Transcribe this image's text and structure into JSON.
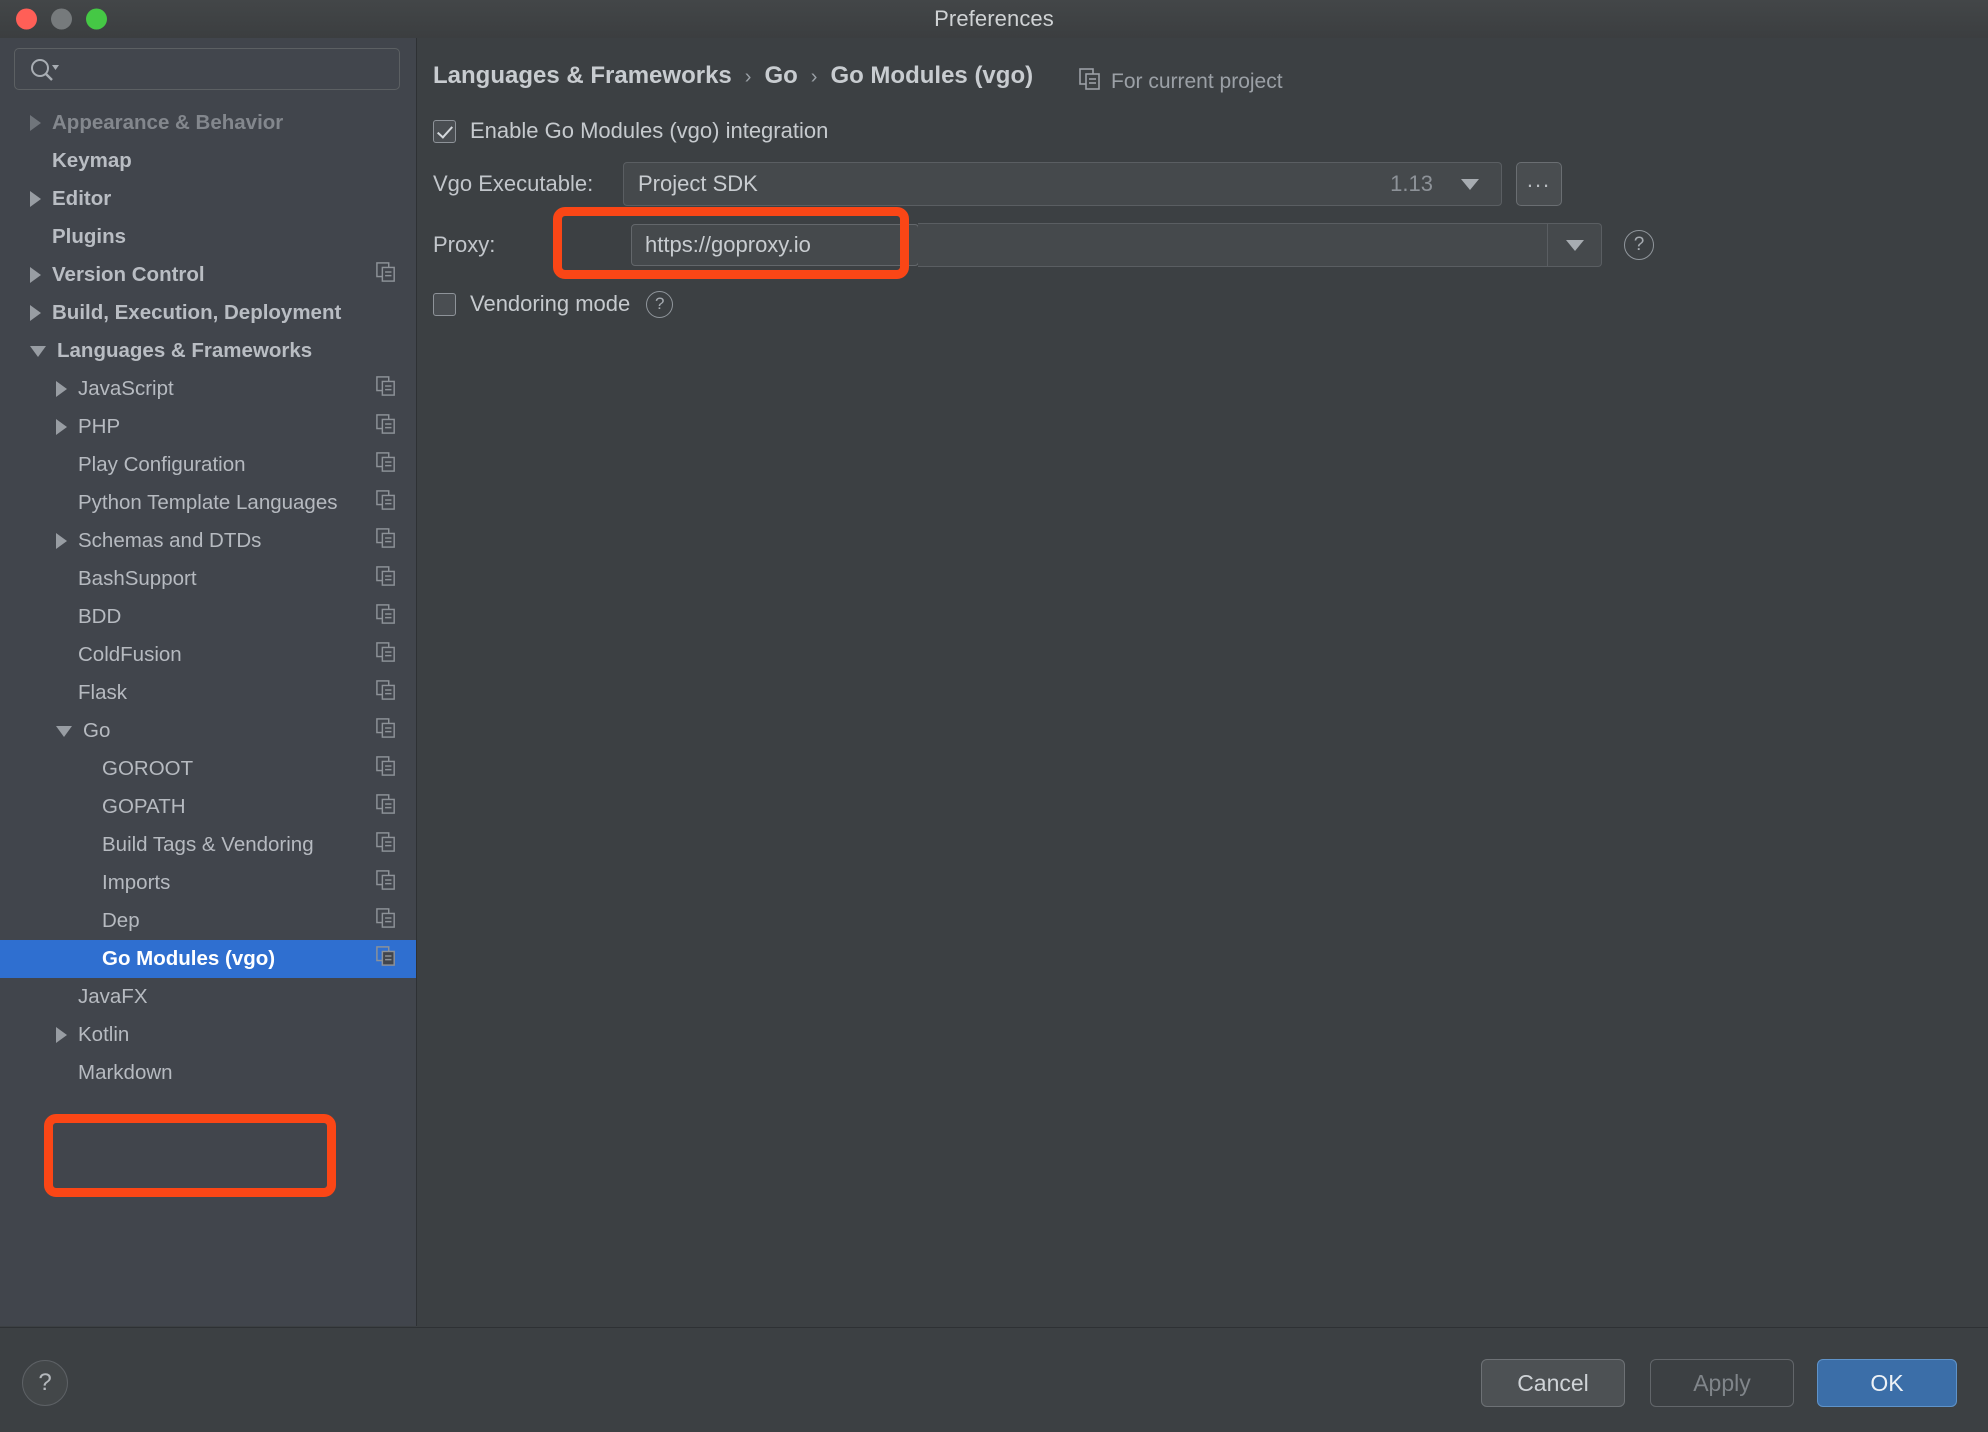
{
  "window": {
    "title": "Preferences",
    "traffic_lights": [
      "close",
      "minimize",
      "maximize"
    ]
  },
  "sidebar": {
    "search": {
      "value": "",
      "placeholder": ""
    },
    "items": [
      {
        "label": "Appearance & Behavior",
        "twisty": "right",
        "level": 0,
        "top": true,
        "faded": true,
        "copy": false
      },
      {
        "label": "Keymap",
        "twisty": "none",
        "level": 0,
        "top": true,
        "copy": false
      },
      {
        "label": "Editor",
        "twisty": "right",
        "level": 0,
        "top": true,
        "copy": false
      },
      {
        "label": "Plugins",
        "twisty": "none",
        "level": 0,
        "top": true,
        "copy": false
      },
      {
        "label": "Version Control",
        "twisty": "right",
        "level": 0,
        "top": true,
        "copy": true
      },
      {
        "label": "Build, Execution, Deployment",
        "twisty": "right",
        "level": 0,
        "top": true,
        "copy": false
      },
      {
        "label": "Languages & Frameworks",
        "twisty": "down",
        "level": 0,
        "top": true,
        "copy": false
      },
      {
        "label": "JavaScript",
        "twisty": "right",
        "level": 1,
        "copy": true
      },
      {
        "label": "PHP",
        "twisty": "right",
        "level": 1,
        "copy": true
      },
      {
        "label": "Play Configuration",
        "twisty": "none",
        "level": 1,
        "copy": true
      },
      {
        "label": "Python Template Languages",
        "twisty": "none",
        "level": 1,
        "copy": true
      },
      {
        "label": "Schemas and DTDs",
        "twisty": "right",
        "level": 1,
        "copy": true
      },
      {
        "label": "BashSupport",
        "twisty": "none",
        "level": 1,
        "copy": true
      },
      {
        "label": "BDD",
        "twisty": "none",
        "level": 1,
        "copy": true
      },
      {
        "label": "ColdFusion",
        "twisty": "none",
        "level": 1,
        "copy": true
      },
      {
        "label": "Flask",
        "twisty": "none",
        "level": 1,
        "copy": true
      },
      {
        "label": "Go",
        "twisty": "down",
        "level": 1,
        "copy": true
      },
      {
        "label": "GOROOT",
        "twisty": "none",
        "level": 2,
        "copy": true
      },
      {
        "label": "GOPATH",
        "twisty": "none",
        "level": 2,
        "copy": true
      },
      {
        "label": "Build Tags & Vendoring",
        "twisty": "none",
        "level": 2,
        "copy": true
      },
      {
        "label": "Imports",
        "twisty": "none",
        "level": 2,
        "copy": true
      },
      {
        "label": "Dep",
        "twisty": "none",
        "level": 2,
        "copy": true
      },
      {
        "label": "Go Modules (vgo)",
        "twisty": "none",
        "level": 2,
        "copy": true,
        "selected": true
      },
      {
        "label": "JavaFX",
        "twisty": "none",
        "level": 1,
        "copy": false
      },
      {
        "label": "Kotlin",
        "twisty": "right",
        "level": 1,
        "copy": false
      },
      {
        "label": "Markdown",
        "twisty": "none",
        "level": 1,
        "copy": false
      }
    ]
  },
  "main": {
    "breadcrumb": [
      "Languages & Frameworks",
      "Go",
      "Go Modules (vgo)"
    ],
    "breadcrumb_separator": "›",
    "scope_note": "For current project",
    "enable_checkbox": {
      "label": "Enable Go Modules (vgo) integration",
      "checked": true
    },
    "vgo_executable": {
      "label": "Vgo Executable:",
      "value": "Project SDK",
      "version_hint": "1.13",
      "browse_label": "..."
    },
    "proxy": {
      "label": "Proxy:",
      "value": "https://goproxy.io"
    },
    "vendoring_checkbox": {
      "label": "Vendoring mode",
      "checked": false
    },
    "help_glyph": "?"
  },
  "footer": {
    "help_glyph": "?",
    "cancel_label": "Cancel",
    "apply_label": "Apply",
    "apply_enabled": false,
    "ok_label": "OK"
  },
  "annotations": [
    {
      "name": "proxy-field-highlight",
      "color": "#fa4616"
    },
    {
      "name": "sidebar-selection-highlight",
      "color": "#fa4616"
    }
  ]
}
